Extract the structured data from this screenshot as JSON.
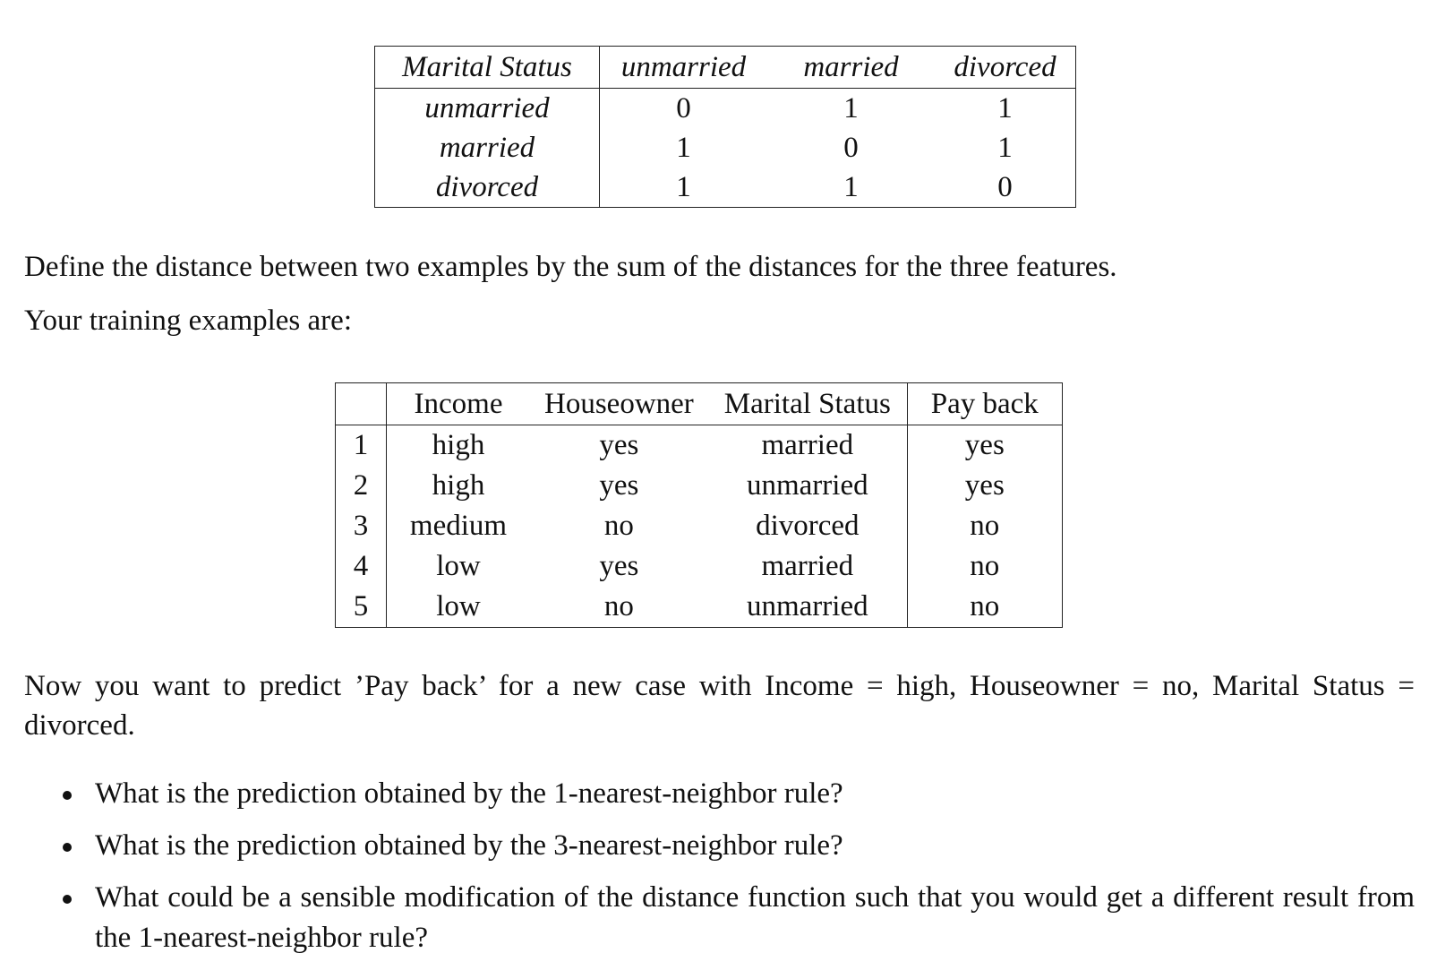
{
  "distance_table": {
    "header": [
      "Marital Status",
      "unmarried",
      "married",
      "divorced"
    ],
    "rows": [
      {
        "label": "unmarried",
        "values": [
          "0",
          "1",
          "1"
        ]
      },
      {
        "label": "married",
        "values": [
          "1",
          "0",
          "1"
        ]
      },
      {
        "label": "divorced",
        "values": [
          "1",
          "1",
          "0"
        ]
      }
    ]
  },
  "paragraph_1": "Define the distance between two examples by the sum of the distances for the three features.",
  "paragraph_2": "Your training examples are:",
  "training_table": {
    "header": [
      "",
      "Income",
      "Houseowner",
      "Marital Status",
      "Pay back"
    ],
    "rows": [
      [
        "1",
        "high",
        "yes",
        "married",
        "yes"
      ],
      [
        "2",
        "high",
        "yes",
        "unmarried",
        "yes"
      ],
      [
        "3",
        "medium",
        "no",
        "divorced",
        "no"
      ],
      [
        "4",
        "low",
        "yes",
        "married",
        "no"
      ],
      [
        "5",
        "low",
        "no",
        "unmarried",
        "no"
      ]
    ]
  },
  "paragraph_3": "Now you want to predict ’Pay back’ for a new case with Income = high, Houseowner = no, Marital Status = divorced.",
  "questions": [
    "What is the prediction obtained by the 1-nearest-neighbor rule?",
    "What is the prediction obtained by the 3-nearest-neighbor rule?",
    "What could be a sensible modification of the distance function such that you would get a different result from the 1-nearest-neighbor rule?"
  ]
}
